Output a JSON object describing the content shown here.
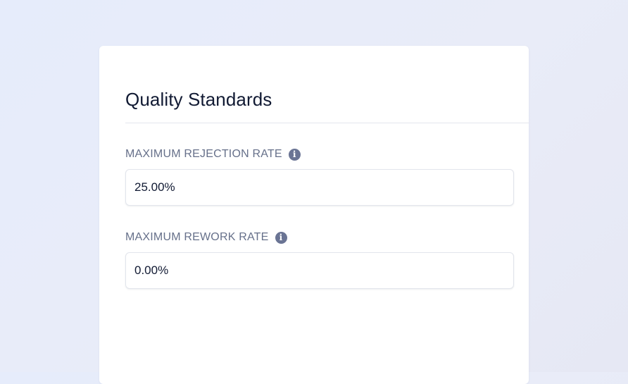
{
  "section": {
    "title": "Quality Standards"
  },
  "fields": {
    "rejection": {
      "label": "MAXIMUM REJECTION RATE",
      "value": "25.00%",
      "info_icon": "info-icon",
      "info_glyph": "i"
    },
    "rework": {
      "label": "MAXIMUM REWORK RATE",
      "value": "0.00%",
      "info_icon": "info-icon",
      "info_glyph": "i"
    }
  },
  "colors": {
    "title_text": "#111a33",
    "label_text": "#66708a",
    "info_icon_bg": "#6a7494",
    "input_border": "#e2e5ec",
    "card_bg": "#ffffff"
  }
}
